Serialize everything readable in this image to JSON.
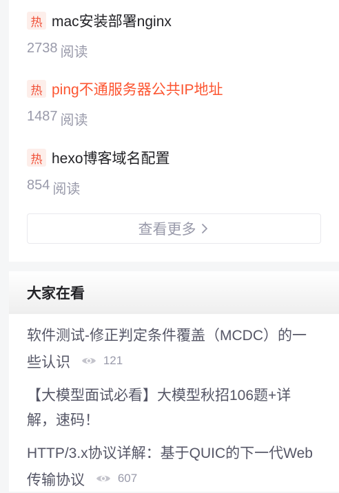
{
  "hot": {
    "badge": "热",
    "items": [
      {
        "title": "mac安装部署nginx",
        "reads": "2738",
        "reads_suffix": "阅读"
      },
      {
        "title": "ping不通服务器公共IP地址",
        "reads": "1487",
        "reads_suffix": "阅读"
      },
      {
        "title": "hexo博客域名配置",
        "reads": "854",
        "reads_suffix": "阅读"
      }
    ],
    "more_label": "查看更多"
  },
  "watching": {
    "title": "大家在看",
    "items": [
      {
        "title": "软件测试-修正判定条件覆盖（MCDC）的一些认识",
        "views": "121"
      },
      {
        "title": "【大模型面试必看】大模型秋招106题+详解，速码！",
        "views": ""
      },
      {
        "title": "HTTP/3.x协议详解：基于QUIC的下一代Web传输协议",
        "views": "607"
      }
    ]
  },
  "colors": {
    "accent": "#fc5531",
    "badge_bg": "#fdeeea",
    "muted": "#999aaa",
    "text": "#222226"
  },
  "icons": {
    "hot_badge": "fire-text-badge",
    "more": "chevron-right-icon",
    "views": "eye-icon"
  }
}
